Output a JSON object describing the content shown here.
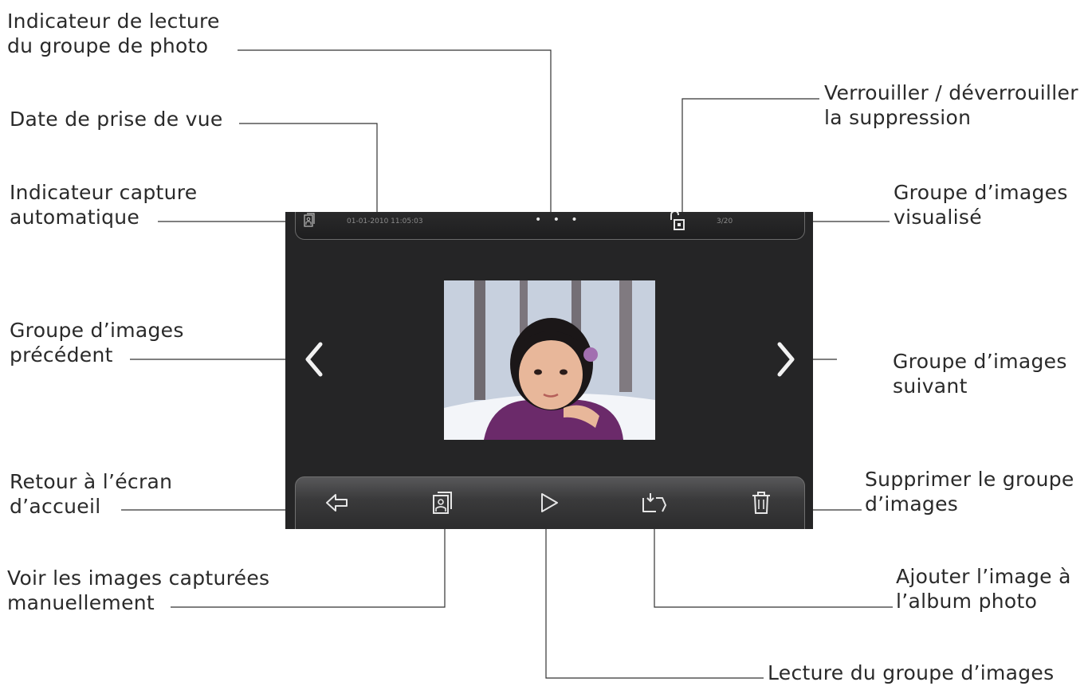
{
  "callouts": {
    "playback_indicator": [
      "Indicateur de lecture",
      "du groupe de photo"
    ],
    "capture_date": [
      "Date de prise de vue"
    ],
    "auto_capture": [
      "Indicateur capture",
      "automatique"
    ],
    "previous_group": [
      "Groupe d’images",
      "précédent"
    ],
    "home": [
      "Retour à l’écran",
      "d’accueil"
    ],
    "manual_images": [
      "Voir les images capturées",
      "manuellement"
    ],
    "lock_delete": [
      "Verrouiller / déverrouiller",
      "la suppression"
    ],
    "group_viewed": [
      "Groupe d’images",
      "visualisé"
    ],
    "next_group": [
      "Groupe d’images",
      "suivant"
    ],
    "delete_group": [
      "Supprimer le groupe",
      "d’images"
    ],
    "add_album": [
      "Ajouter l’image à",
      "l’album photo"
    ],
    "play_group": [
      "Lecture du groupe d’images"
    ]
  },
  "screen": {
    "date_time": "01-01-2010  11:05:03",
    "counter": "3/20",
    "dots": "• • •",
    "icons": {
      "auto_capture": "auto-capture-icon",
      "lock": "unlock-icon",
      "previous": "chevron-left-icon",
      "next": "chevron-right-icon",
      "home": "back-arrow-icon",
      "manual": "manual-capture-icon",
      "play": "play-icon",
      "album": "add-to-album-icon",
      "delete": "trash-icon"
    }
  },
  "colors": {
    "screen_bg": "#252526",
    "toolbar_top": "#58585a",
    "icon": "#e6e6e6",
    "label_text": "#2a2a2a"
  }
}
